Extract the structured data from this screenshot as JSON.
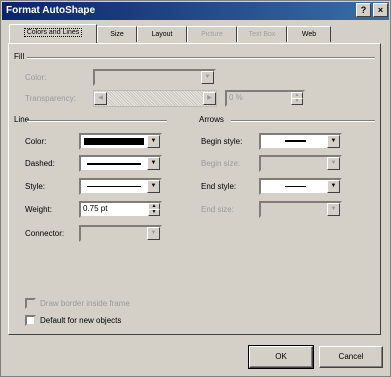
{
  "title": "Format AutoShape",
  "title_buttons": {
    "help": "?",
    "close": "×"
  },
  "tabs": [
    {
      "label": "Colors and Lines",
      "active": true
    },
    {
      "label": "Size"
    },
    {
      "label": "Layout"
    },
    {
      "label": "Picture",
      "disabled": true
    },
    {
      "label": "Text Box",
      "disabled": true
    },
    {
      "label": "Web"
    }
  ],
  "fill": {
    "group_label": "Fill",
    "color_label": "Color:",
    "transparency_label": "Transparency:",
    "transparency_value": "0 %"
  },
  "line": {
    "group_label": "Line",
    "color_label": "Color:",
    "dashed_label": "Dashed:",
    "style_label": "Style:",
    "weight_label": "Weight:",
    "weight_value": "0.75 pt",
    "connector_label": "Connector:"
  },
  "arrows": {
    "group_label": "Arrows",
    "begin_style_label": "Begin style:",
    "begin_size_label": "Begin size:",
    "end_style_label": "End style:",
    "end_size_label": "End size:"
  },
  "checkboxes": {
    "draw_border_inside_frame": "Draw border inside frame",
    "default_for_new_objects": "Default for new objects"
  },
  "buttons": {
    "ok": "OK",
    "cancel": "Cancel"
  },
  "colors": {
    "line_color": "#000000",
    "title_bar": "#0a246a"
  },
  "icons": {
    "dropdown": "chevron-down-icon",
    "spin_up": "spin-up-icon",
    "spin_down": "spin-down-icon"
  }
}
